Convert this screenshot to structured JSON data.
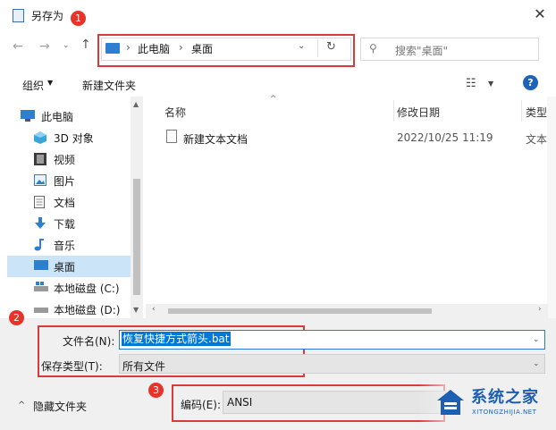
{
  "window": {
    "title": "另存为"
  },
  "badges": {
    "b1": "1",
    "b2": "2",
    "b3": "3"
  },
  "nav": {
    "back": "←",
    "forward": "→",
    "recent": "⌄",
    "up": "↑"
  },
  "address": {
    "sep": "›",
    "this_pc": "此电脑",
    "desktop": "桌面",
    "dropdown": "⌄",
    "refresh": "↻"
  },
  "search": {
    "placeholder": "搜索\"桌面\""
  },
  "toolbar": {
    "organize": "组织",
    "new_folder": "新建文件夹",
    "help": "?"
  },
  "sidebar": {
    "items": [
      {
        "label": "此电脑",
        "icon": "computer-icon"
      },
      {
        "label": "3D 对象",
        "icon": "cube-icon"
      },
      {
        "label": "视频",
        "icon": "film-icon"
      },
      {
        "label": "图片",
        "icon": "picture-icon"
      },
      {
        "label": "文档",
        "icon": "document-icon"
      },
      {
        "label": "下载",
        "icon": "download-arrow-icon"
      },
      {
        "label": "音乐",
        "icon": "music-note-icon"
      },
      {
        "label": "桌面",
        "icon": "desktop-icon"
      },
      {
        "label": "本地磁盘 (C:)",
        "icon": "drive-icon"
      },
      {
        "label": "本地磁盘 (D:)",
        "icon": "drive-icon"
      }
    ],
    "selected": "桌面"
  },
  "columns": {
    "name": "名称",
    "date": "修改日期",
    "type": "类型"
  },
  "files": [
    {
      "name": "新建文本文档",
      "date": "2022/10/25 11:19",
      "type": "文本"
    }
  ],
  "form": {
    "filename_label": "文件名(N):",
    "filename_value": "恢复快捷方式箭头.bat",
    "filetype_label": "保存类型(T):",
    "filetype_value": "所有文件",
    "encoding_label": "编码(E):",
    "encoding_value": "ANSI",
    "hide_folders": "隐藏文件夹"
  },
  "watermark": {
    "name": "系统之家",
    "url": "XITONGZHIJIA.NET"
  },
  "colors": {
    "accent": "#0078d7",
    "highlight_box": "#d93a3a",
    "badge": "#e8332a",
    "selected_row": "#cce4f7"
  }
}
